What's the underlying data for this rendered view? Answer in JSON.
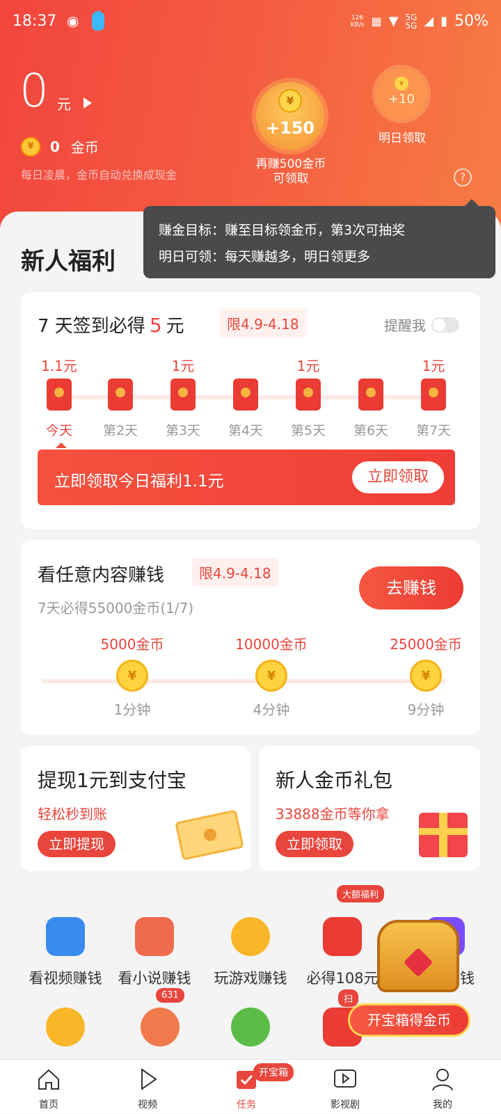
{
  "status_bar": {
    "time": "18:37",
    "speed_top": "126",
    "speed_bottom": "KB/s",
    "network": "5G",
    "network2": "5G",
    "battery": "50%"
  },
  "balance": {
    "amount": "0",
    "unit": "元",
    "coins": "0",
    "coins_label": "金币",
    "note": "每日凌晨，金币自动兑换成现金"
  },
  "goal": {
    "coin_symbol": "¥",
    "amount": "+150",
    "caption_line1": "再赚500金币",
    "caption_line2": "可领取"
  },
  "tomorrow": {
    "amount": "+10",
    "caption": "明日领取"
  },
  "help_icon_text": "?",
  "tooltip": {
    "line1": "赚金目标：赚至目标领金币，第3次可抽奖",
    "line2": "明日可领：每天赚越多，明日领更多"
  },
  "section_title": "新人福利",
  "signin": {
    "title_prefix": "7 天签到必得",
    "title_amount": "5",
    "title_suffix": "元",
    "tag": "限4.9-4.18",
    "remind_label": "提醒我",
    "remind_on": false,
    "days": [
      {
        "amount": "1.1元",
        "label": "今天"
      },
      {
        "amount": "",
        "label": "第2天"
      },
      {
        "amount": "1元",
        "label": "第3天"
      },
      {
        "amount": "",
        "label": "第4天"
      },
      {
        "amount": "1元",
        "label": "第5天"
      },
      {
        "amount": "",
        "label": "第6天"
      },
      {
        "amount": "1元",
        "label": "第7天"
      }
    ],
    "claim_text": "立即领取今日福利1.1元",
    "claim_button": "立即领取"
  },
  "watch": {
    "title": "看任意内容赚钱",
    "tag": "限4.9-4.18",
    "subtitle": "7天必得55000金币(1/7)",
    "button": "去赚钱",
    "milestones": [
      {
        "coins": "5000金币",
        "time": "1分钟"
      },
      {
        "coins": "10000金币",
        "time": "4分钟"
      },
      {
        "coins": "25000金币",
        "time": "9分钟"
      }
    ]
  },
  "withdraw": {
    "title": "提现1元到支付宝",
    "subtitle": "轻松秒到账",
    "button": "立即提现"
  },
  "gift": {
    "title": "新人金币礼包",
    "subtitle": "33888金币等你拿",
    "button": "立即领取"
  },
  "grid": {
    "items": [
      {
        "label": "看视频赚钱",
        "icon": "video-icon",
        "color": "#3a8bf0"
      },
      {
        "label": "看小说赚钱",
        "icon": "book-icon",
        "color": "#f06a4c"
      },
      {
        "label": "玩游戏赚钱",
        "icon": "pacman-icon",
        "color": "#f9b629"
      },
      {
        "label": "必得108元",
        "icon": "red-packet-icon",
        "color": "#ea3b34"
      },
      {
        "label": "走路赚钱",
        "icon": "run-icon",
        "color": "#7b4bff"
      }
    ],
    "badge_big": "大额福利",
    "badge_631": "631",
    "badge_scan": "扫"
  },
  "chest": {
    "button": "开宝箱得金币"
  },
  "tabbar": {
    "items": [
      {
        "label": "首页",
        "icon": "home-icon"
      },
      {
        "label": "视频",
        "icon": "play-icon"
      },
      {
        "label": "任务",
        "icon": "task-icon"
      },
      {
        "label": "影视剧",
        "icon": "tv-icon"
      },
      {
        "label": "我的",
        "icon": "profile-icon"
      }
    ],
    "active": "任务",
    "badge": "开宝箱"
  }
}
